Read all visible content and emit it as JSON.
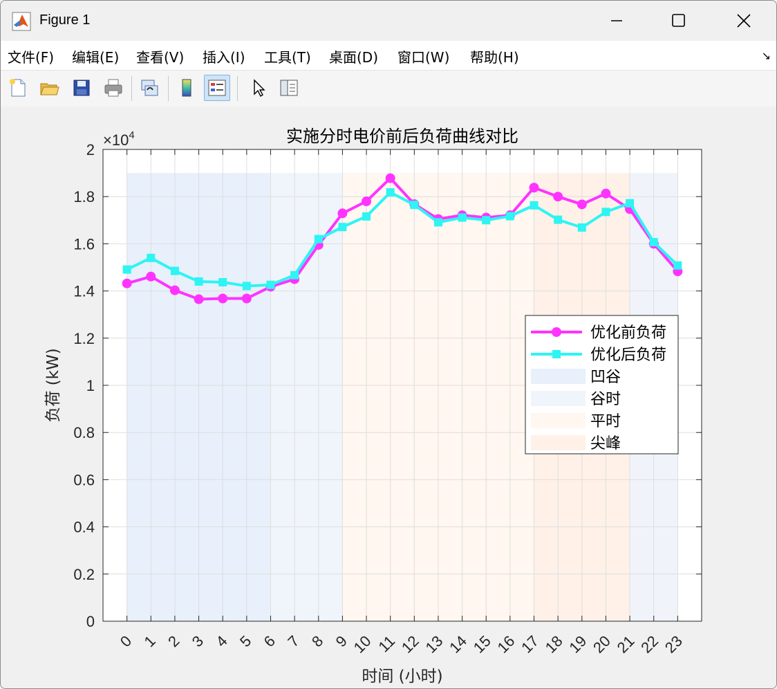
{
  "window": {
    "title": "Figure 1",
    "minimize_glyph": "—",
    "maximize_glyph": "☐",
    "close_glyph": "✕"
  },
  "menu": {
    "items": [
      {
        "label": "文件(F)"
      },
      {
        "label": "编辑(E)"
      },
      {
        "label": "查看(V)"
      },
      {
        "label": "插入(I)"
      },
      {
        "label": "工具(T)"
      },
      {
        "label": "桌面(D)"
      },
      {
        "label": "窗口(W)"
      },
      {
        "label": "帮助(H)"
      }
    ],
    "dock_arrow": "↘"
  },
  "toolbar": {
    "icons": [
      "new-figure-icon",
      "open-file-icon",
      "save-icon",
      "print-icon",
      "link-plot-icon",
      "colorbar-icon",
      "legend-icon",
      "edit-plot-icon",
      "property-inspector-icon"
    ]
  },
  "chart_data": {
    "type": "line",
    "title": "实施分时电价前后负荷曲线对比",
    "xlabel": "时间 (小时)",
    "ylabel": "负荷 (kW)",
    "exponent_label": "×10",
    "exponent_sup": "4",
    "x": [
      0,
      1,
      2,
      3,
      4,
      5,
      6,
      7,
      8,
      9,
      10,
      11,
      12,
      13,
      14,
      15,
      16,
      17,
      18,
      19,
      20,
      21,
      22,
      23
    ],
    "xlim": [
      -1,
      24
    ],
    "ylim": [
      0,
      2
    ],
    "yticks": [
      0,
      0.2,
      0.4,
      0.6,
      0.8,
      1,
      1.2,
      1.4,
      1.6,
      1.8,
      2
    ],
    "ytick_labels": [
      "0",
      "0.2",
      "0.4",
      "0.6",
      "0.8",
      "1",
      "1.2",
      "1.4",
      "1.6",
      "1.8",
      "2"
    ],
    "grid": true,
    "series": [
      {
        "name": "优化前负荷",
        "color": "#ff33ff",
        "marker": "circle",
        "values": [
          1.432,
          1.461,
          1.403,
          1.365,
          1.368,
          1.368,
          1.418,
          1.45,
          1.595,
          1.729,
          1.78,
          1.878,
          1.768,
          1.705,
          1.721,
          1.711,
          1.721,
          1.838,
          1.8,
          1.767,
          1.813,
          1.747,
          1.6,
          1.483
        ]
      },
      {
        "name": "优化后负荷",
        "color": "#2ef4f4",
        "marker": "square",
        "values": [
          1.491,
          1.54,
          1.485,
          1.44,
          1.437,
          1.421,
          1.426,
          1.467,
          1.62,
          1.671,
          1.716,
          1.818,
          1.765,
          1.691,
          1.711,
          1.7,
          1.717,
          1.763,
          1.702,
          1.669,
          1.735,
          1.772,
          1.607,
          1.508
        ]
      }
    ],
    "bands": [
      {
        "name": "凹谷",
        "color": "#e8f0fb",
        "x0": 0,
        "x1": 6,
        "height": 1.9
      },
      {
        "name": "谷时",
        "color": "#f0f5fb",
        "x0": 6,
        "x1": 9,
        "height": 1.9
      },
      {
        "name": "平时",
        "color": "#fff7f0",
        "x0": 9,
        "x1": 17,
        "height": 1.9
      },
      {
        "name": "尖峰",
        "color": "#fff1e8",
        "x0": 17,
        "x1": 21,
        "height": 1.9
      },
      {
        "name": "",
        "color": "#f0f4fa",
        "x0": 21,
        "x1": 23,
        "height": 1.9
      }
    ],
    "legend": {
      "placement": "right",
      "entries": [
        "优化前负荷",
        "优化后负荷",
        "凹谷",
        "谷时",
        "平时",
        "尖峰"
      ]
    }
  }
}
